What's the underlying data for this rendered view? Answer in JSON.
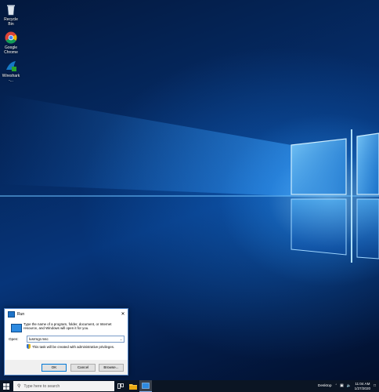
{
  "desktop": {
    "icons": [
      {
        "label": "Recycle Bin",
        "icon": "recycle-bin-icon"
      },
      {
        "label": "Google Chrome",
        "icon": "chrome-icon"
      },
      {
        "label": "Wireshark -...",
        "icon": "wireshark-icon"
      }
    ]
  },
  "run_dialog": {
    "title": "Run",
    "close_glyph": "✕",
    "description": "Type the name of a program, folder, document, or Internet resource, and Windows will open it for you.",
    "open_label": "Open:",
    "open_value": "lusrmgr.msc",
    "admin_note": "This task will be created with administrative privileges.",
    "ok": "OK",
    "cancel": "Cancel",
    "browse": "Browse..."
  },
  "taskbar": {
    "search_placeholder": "Type here to search",
    "desktop_label": "Desktop",
    "time": "11:04 AM",
    "date": "1/27/2020",
    "accent": "#0b1524"
  }
}
